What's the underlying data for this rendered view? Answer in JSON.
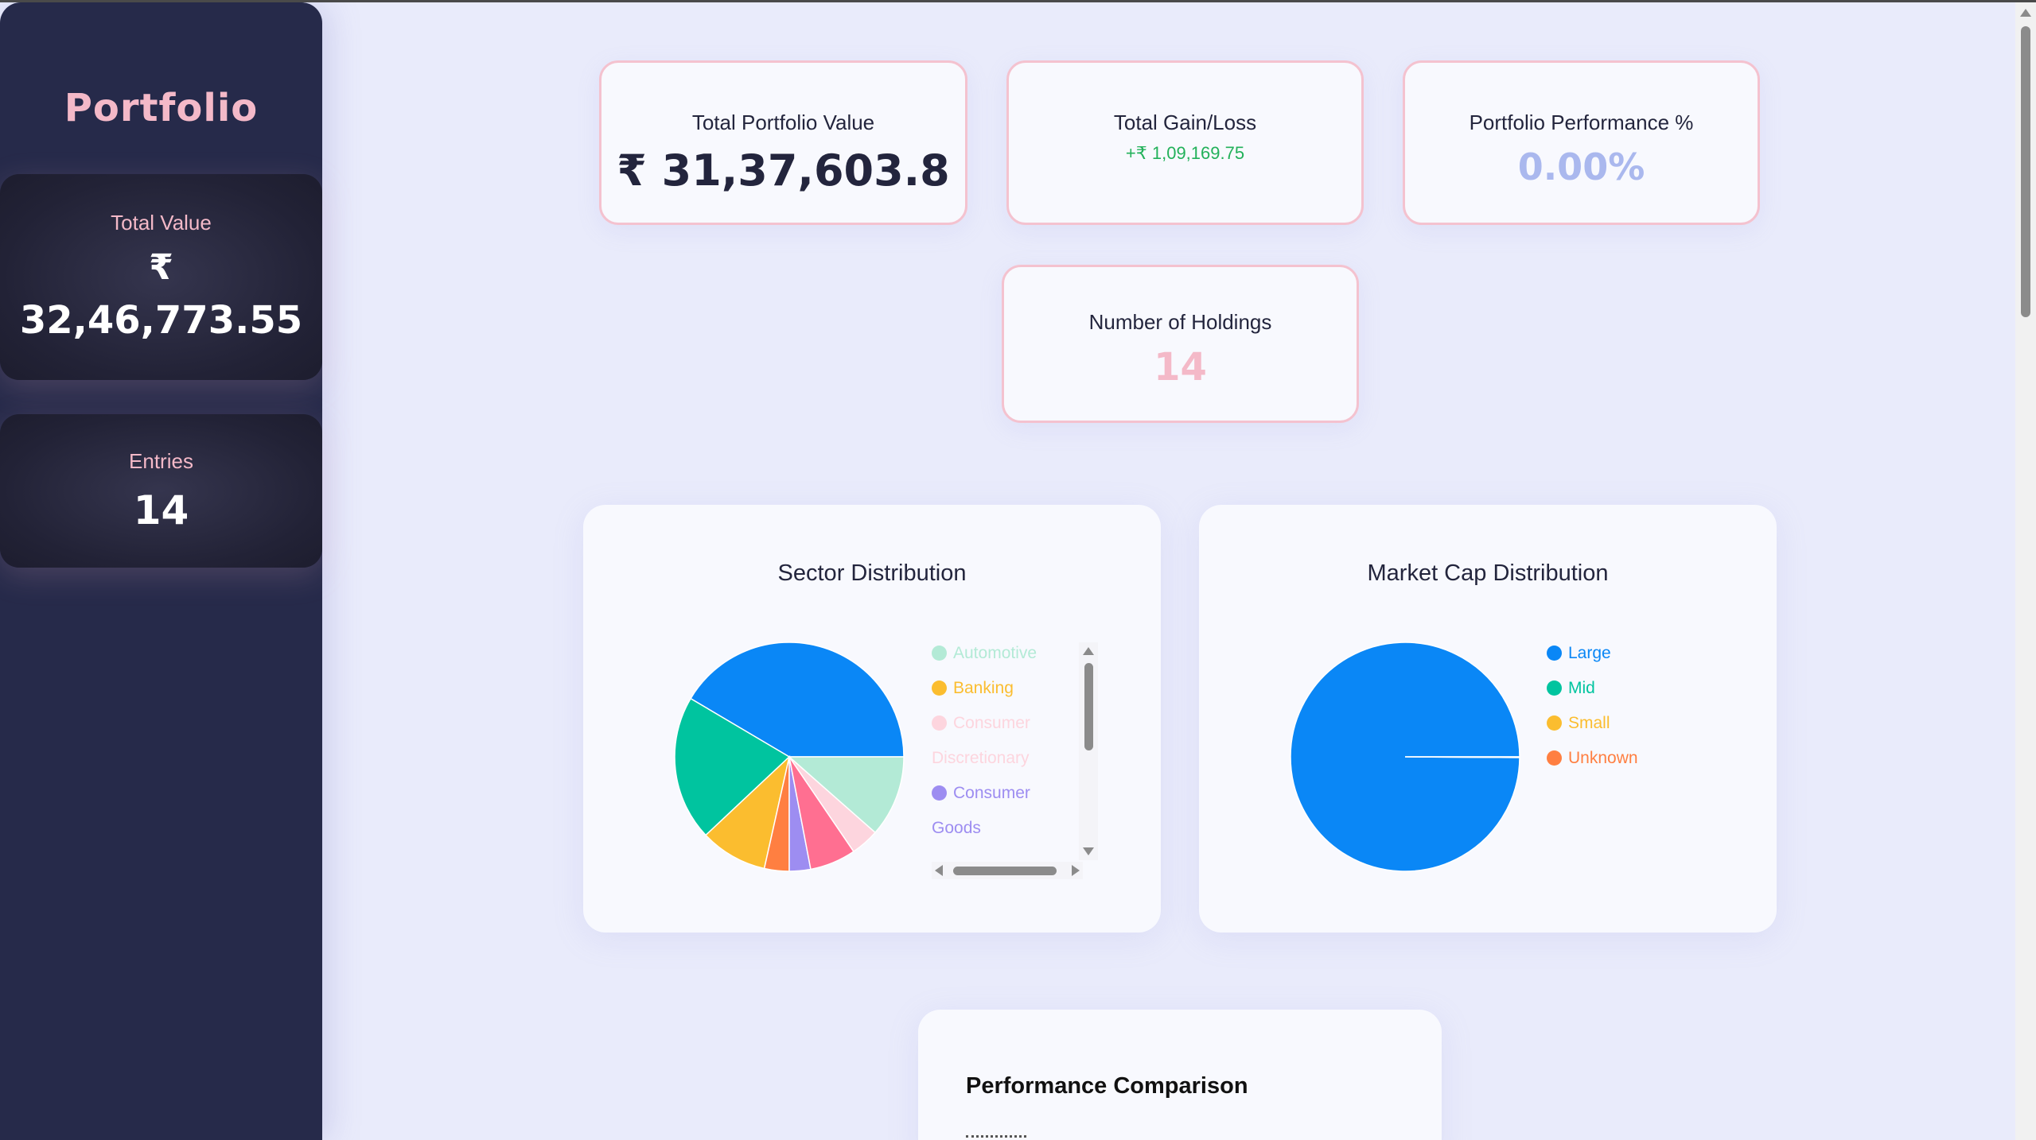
{
  "sidebar": {
    "brand": "Portfolio",
    "total": {
      "label": "Total Value",
      "currency": "₹",
      "value": "32,46,773.55"
    },
    "entries": {
      "label": "Entries",
      "value": "14"
    }
  },
  "stats": {
    "portfolio_value": {
      "label": "Total Portfolio Value",
      "value": "₹ 31,37,603.8"
    },
    "gain_loss": {
      "label": "Total Gain/Loss",
      "value": "+₹ 1,09,169.75"
    },
    "performance": {
      "label": "Portfolio Performance %",
      "value": "0.00%"
    },
    "holdings": {
      "label": "Number of Holdings",
      "value": "14"
    }
  },
  "panels": {
    "sector_title": "Sector Distribution",
    "marketcap_title": "Market Cap Distribution",
    "performance_title": "Performance Comparison"
  },
  "sector_legend": [
    {
      "line1": "Automotive",
      "line2": "",
      "color": "#b3ead6"
    },
    {
      "line1": "Banking",
      "line2": "",
      "color": "#fbbd2f"
    },
    {
      "line1": "Consumer",
      "line2": "Discretionary",
      "color": "#fdd5de"
    },
    {
      "line1": "Consumer",
      "line2": "Goods",
      "color": "#9d8df1"
    }
  ],
  "marketcap_legend": [
    {
      "label": "Large",
      "color": "#0a87f6"
    },
    {
      "label": "Mid",
      "color": "#00c49f"
    },
    {
      "label": "Small",
      "color": "#fbbd2f"
    },
    {
      "label": "Unknown",
      "color": "#ff7f41"
    }
  ],
  "chart_data": [
    {
      "type": "pie",
      "title": "Sector Distribution",
      "slices": [
        {
          "label": "",
          "value": 41.5,
          "color": "#0a87f6"
        },
        {
          "label": "",
          "value": 20.5,
          "color": "#00c49f"
        },
        {
          "label": "",
          "value": 9.5,
          "color": "#fbbd2f"
        },
        {
          "label": "",
          "value": 3.5,
          "color": "#ff7f41"
        },
        {
          "label": "",
          "value": 3.0,
          "color": "#9d8df1"
        },
        {
          "label": "",
          "value": 6.5,
          "color": "#ff6f91"
        },
        {
          "label": "",
          "value": 4.0,
          "color": "#fdd5de"
        },
        {
          "label": "",
          "value": 11.5,
          "color": "#b3ead6"
        }
      ]
    },
    {
      "type": "pie",
      "title": "Market Cap Distribution",
      "slices": [
        {
          "label": "Large",
          "value": 99.9,
          "color": "#0a87f6"
        },
        {
          "label": "Mid",
          "value": 0.0,
          "color": "#00c49f"
        },
        {
          "label": "Small",
          "value": 0.0,
          "color": "#fbbd2f"
        },
        {
          "label": "Unknown",
          "value": 0.1,
          "color": "#ff7f41"
        }
      ]
    }
  ]
}
